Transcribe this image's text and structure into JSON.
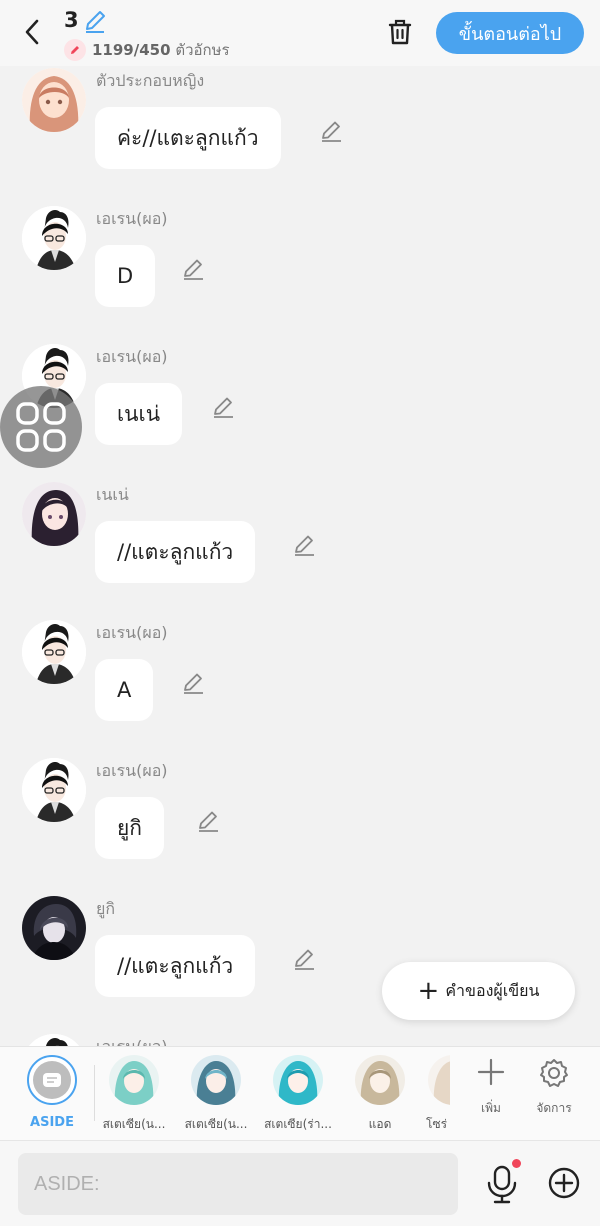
{
  "header": {
    "episode_number": "3",
    "char_count": "1199/450",
    "char_unit": "ตัวอักษร",
    "next_label": "ขั้นตอนต่อไป"
  },
  "messages": [
    {
      "speaker": "ตัวประกอบหญิง",
      "text": "ค่ะ//แตะลูกแก้ว",
      "avatar": "female-extra"
    },
    {
      "speaker": "เอเรน(ผอ)",
      "text": "D",
      "avatar": "eren"
    },
    {
      "speaker": "เอเรน(ผอ)",
      "text": "เนเน่",
      "avatar": "eren"
    },
    {
      "speaker": "เนเน่",
      "text": "//แตะลูกแก้ว",
      "avatar": "nene"
    },
    {
      "speaker": "เอเรน(ผอ)",
      "text": "A",
      "avatar": "eren"
    },
    {
      "speaker": "เอเรน(ผอ)",
      "text": "ยูกิ",
      "avatar": "eren"
    },
    {
      "speaker": "ยูกิ",
      "text": "//แตะลูกแก้ว",
      "avatar": "yuki"
    },
    {
      "speaker": "เอเรน(ผอ)",
      "text": "",
      "avatar": "eren"
    }
  ],
  "author_button": "คำของผู้เขียน",
  "characters": [
    {
      "label": "ASIDE",
      "selected": true
    },
    {
      "label": "สเตเซีย(น...",
      "selected": false
    },
    {
      "label": "สเตเซีย(น...",
      "selected": false
    },
    {
      "label": "สเตเซีย(ร่า...",
      "selected": false
    },
    {
      "label": "แอด",
      "selected": false
    },
    {
      "label": "โซร่",
      "selected": false
    }
  ],
  "tools": {
    "add_label": "เพิ่ม",
    "manage_label": "จัดการ"
  },
  "input": {
    "placeholder": "ASIDE:"
  },
  "colors": {
    "accent": "#4aa3ef",
    "notify": "#f0455a"
  }
}
